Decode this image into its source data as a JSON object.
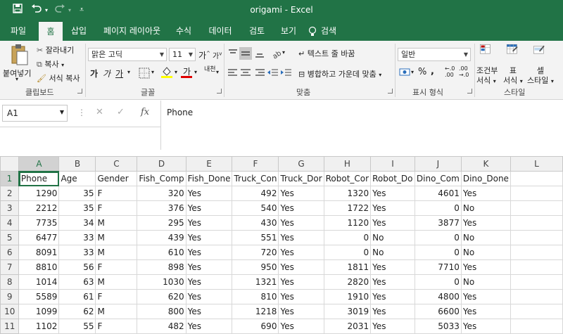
{
  "titlebar": {
    "title": "origami  -  Excel"
  },
  "tabs": [
    "파일",
    "홈",
    "삽입",
    "페이지 레이아웃",
    "수식",
    "데이터",
    "검토",
    "보기",
    "검색"
  ],
  "ribbon": {
    "clipboard": {
      "paste": "붙여넣기",
      "cut": "잘라내기",
      "copy": "복사",
      "format_painter": "서식 복사",
      "label": "클립보드"
    },
    "font": {
      "name": "맑은 고딕",
      "size": "11",
      "bold": "가",
      "italic": "가",
      "underline": "가",
      "label": "글꼴",
      "phonetic": "내천"
    },
    "alignment": {
      "wrap": "텍스트 줄 바꿈",
      "merge": "병합하고 가운데 맞춤",
      "label": "맞춤"
    },
    "number": {
      "format": "일반",
      "label": "표시 형식"
    },
    "styles": {
      "conditional": "조건부",
      "conditional2": "서식",
      "table": "표",
      "table2": "서식",
      "cell": "셀",
      "cell2": "스타일",
      "label": "스타일"
    }
  },
  "formula_bar": {
    "name_box": "A1",
    "fx": "fx",
    "content": "Phone"
  },
  "grid": {
    "columns": [
      "A",
      "B",
      "C",
      "D",
      "E",
      "F",
      "G",
      "H",
      "I",
      "J",
      "K",
      "L"
    ],
    "header_row": [
      "Phone",
      "Age",
      "Gender",
      "Fish_Comp",
      "Fish_Done",
      "Truck_Con",
      "Truck_Dor",
      "Robot_Cor",
      "Robot_Do",
      "Dino_Com",
      "Dino_Done",
      ""
    ],
    "rows": [
      [
        "1290",
        "35",
        "F",
        "320",
        "Yes",
        "492",
        "Yes",
        "1320",
        "Yes",
        "4601",
        "Yes",
        ""
      ],
      [
        "2212",
        "35",
        "F",
        "376",
        "Yes",
        "540",
        "Yes",
        "1722",
        "Yes",
        "0",
        "No",
        ""
      ],
      [
        "7735",
        "34",
        "M",
        "295",
        "Yes",
        "430",
        "Yes",
        "1120",
        "Yes",
        "3877",
        "Yes",
        ""
      ],
      [
        "6477",
        "33",
        "M",
        "439",
        "Yes",
        "551",
        "Yes",
        "0",
        "No",
        "0",
        "No",
        ""
      ],
      [
        "8091",
        "33",
        "M",
        "610",
        "Yes",
        "720",
        "Yes",
        "0",
        "No",
        "0",
        "No",
        ""
      ],
      [
        "8810",
        "56",
        "F",
        "898",
        "Yes",
        "950",
        "Yes",
        "1811",
        "Yes",
        "7710",
        "Yes",
        ""
      ],
      [
        "1014",
        "63",
        "M",
        "1030",
        "Yes",
        "1321",
        "Yes",
        "2820",
        "Yes",
        "0",
        "No",
        ""
      ],
      [
        "5589",
        "61",
        "F",
        "620",
        "Yes",
        "810",
        "Yes",
        "1910",
        "Yes",
        "4800",
        "Yes",
        ""
      ],
      [
        "1099",
        "62",
        "M",
        "800",
        "Yes",
        "1218",
        "Yes",
        "3019",
        "Yes",
        "6600",
        "Yes",
        ""
      ],
      [
        "1102",
        "55",
        "F",
        "482",
        "Yes",
        "690",
        "Yes",
        "2031",
        "Yes",
        "5033",
        "Yes",
        ""
      ]
    ],
    "row_numbers": [
      "1",
      "2",
      "3",
      "4",
      "5",
      "6",
      "7",
      "8",
      "9",
      "10",
      "11"
    ]
  }
}
